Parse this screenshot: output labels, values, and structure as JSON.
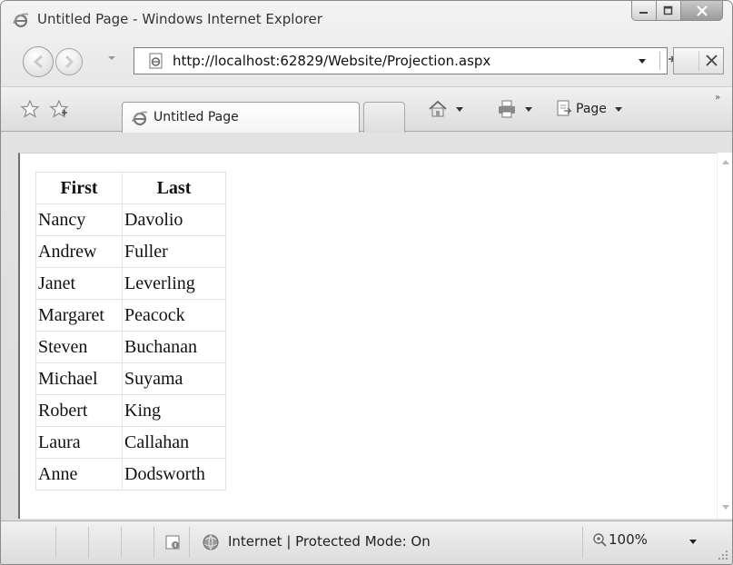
{
  "window": {
    "title": "Untitled Page - Windows Internet Explorer"
  },
  "address": {
    "url": "http://localhost:62829/Website/Projection.aspx"
  },
  "tabs": [
    {
      "label": "Untitled Page",
      "active": true
    }
  ],
  "command_bar": {
    "page_label": "Page",
    "overflow": "»"
  },
  "table": {
    "headers": [
      "First",
      "Last"
    ],
    "rows": [
      [
        "Nancy",
        "Davolio"
      ],
      [
        "Andrew",
        "Fuller"
      ],
      [
        "Janet",
        "Leverling"
      ],
      [
        "Margaret",
        "Peacock"
      ],
      [
        "Steven",
        "Buchanan"
      ],
      [
        "Michael",
        "Suyama"
      ],
      [
        "Robert",
        "King"
      ],
      [
        "Laura",
        "Callahan"
      ],
      [
        "Anne",
        "Dodsworth"
      ]
    ]
  },
  "status": {
    "zone_text": "Internet | Protected Mode: On",
    "zoom": "100%"
  },
  "icons": {
    "ie": "ie-logo-icon",
    "page": "page-icon",
    "refresh": "refresh-icon",
    "stop": "stop-icon",
    "favorites": "favorites-star-icon",
    "add_favorites": "add-favorites-icon",
    "home": "home-icon",
    "print": "print-icon",
    "page_menu": "page-menu-icon",
    "internet": "globe-icon",
    "zoom": "zoom-icon"
  }
}
